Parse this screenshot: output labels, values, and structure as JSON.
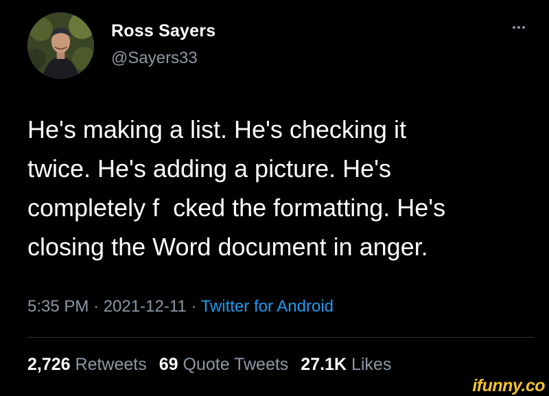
{
  "tweet": {
    "author": {
      "display_name": "Ross Sayers",
      "handle": "@Sayers33"
    },
    "body": "He's making a list. He's checking it\ntwice. He's adding a picture. He's\ncompletely f  cked the formatting. He's\nclosing the Word document in anger.",
    "timestamp": "5:35 PM · 2021-12-11 · ",
    "source": "Twitter for Android",
    "stats": {
      "retweets_count": "2,726",
      "retweets_label": "Retweets",
      "quote_tweets_count": "69",
      "quote_tweets_label": "Quote Tweets",
      "likes_count": "27.1K",
      "likes_label": "Likes"
    },
    "more_icon": "more-horizontal-icon"
  },
  "watermark": {
    "text": "ifunny.co",
    "color": "#f2c230"
  },
  "colors": {
    "background": "#000000",
    "primary_text": "#ffffff",
    "secondary_text": "#8b98a5",
    "link": "#1d9bf0",
    "divider": "#2f3336"
  }
}
